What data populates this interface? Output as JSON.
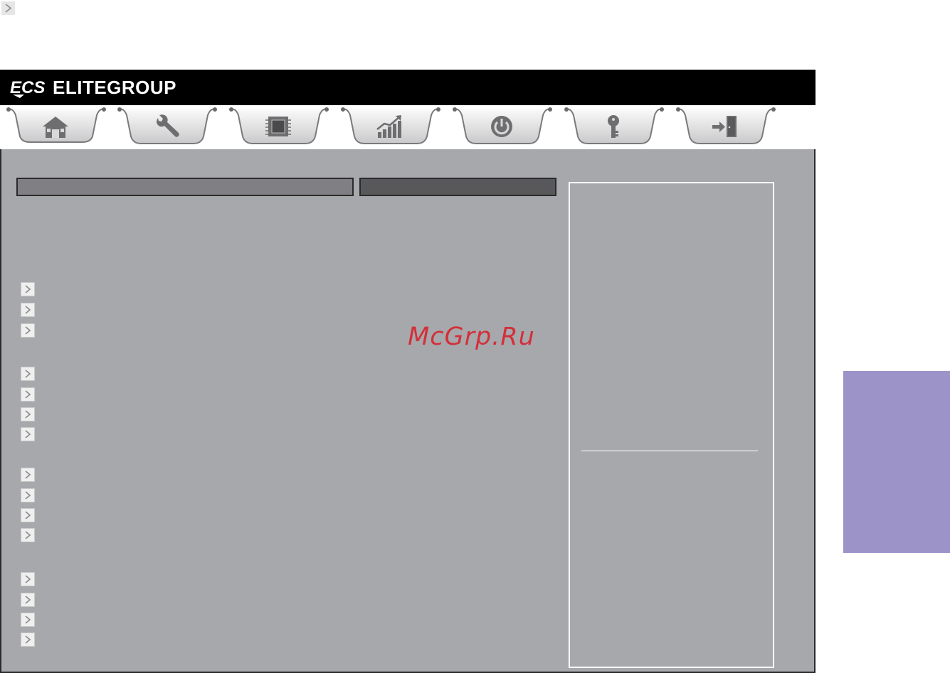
{
  "brand": {
    "logo_mark": "ECS",
    "name": "ELITEGROUP"
  },
  "tabs": [
    {
      "icon": "home-icon",
      "active": true
    },
    {
      "icon": "wrench-icon",
      "active": false
    },
    {
      "icon": "chip-icon",
      "active": false
    },
    {
      "icon": "performance-chart-icon",
      "active": false
    },
    {
      "icon": "power-icon",
      "active": false
    },
    {
      "icon": "key-icon",
      "active": false
    },
    {
      "icon": "exit-icon",
      "active": false
    }
  ],
  "menu_groups": [
    {
      "items": 3
    },
    {
      "items": 4
    },
    {
      "items": 4
    },
    {
      "items": 4
    }
  ],
  "watermark": "McGrp.Ru",
  "colors": {
    "panel_bg": "#a7a8ac",
    "brand_bar": "#000000",
    "header_left": "#808084",
    "header_right": "#58585a",
    "watermark": "#d2303a",
    "side_block": "#9c94c8"
  }
}
